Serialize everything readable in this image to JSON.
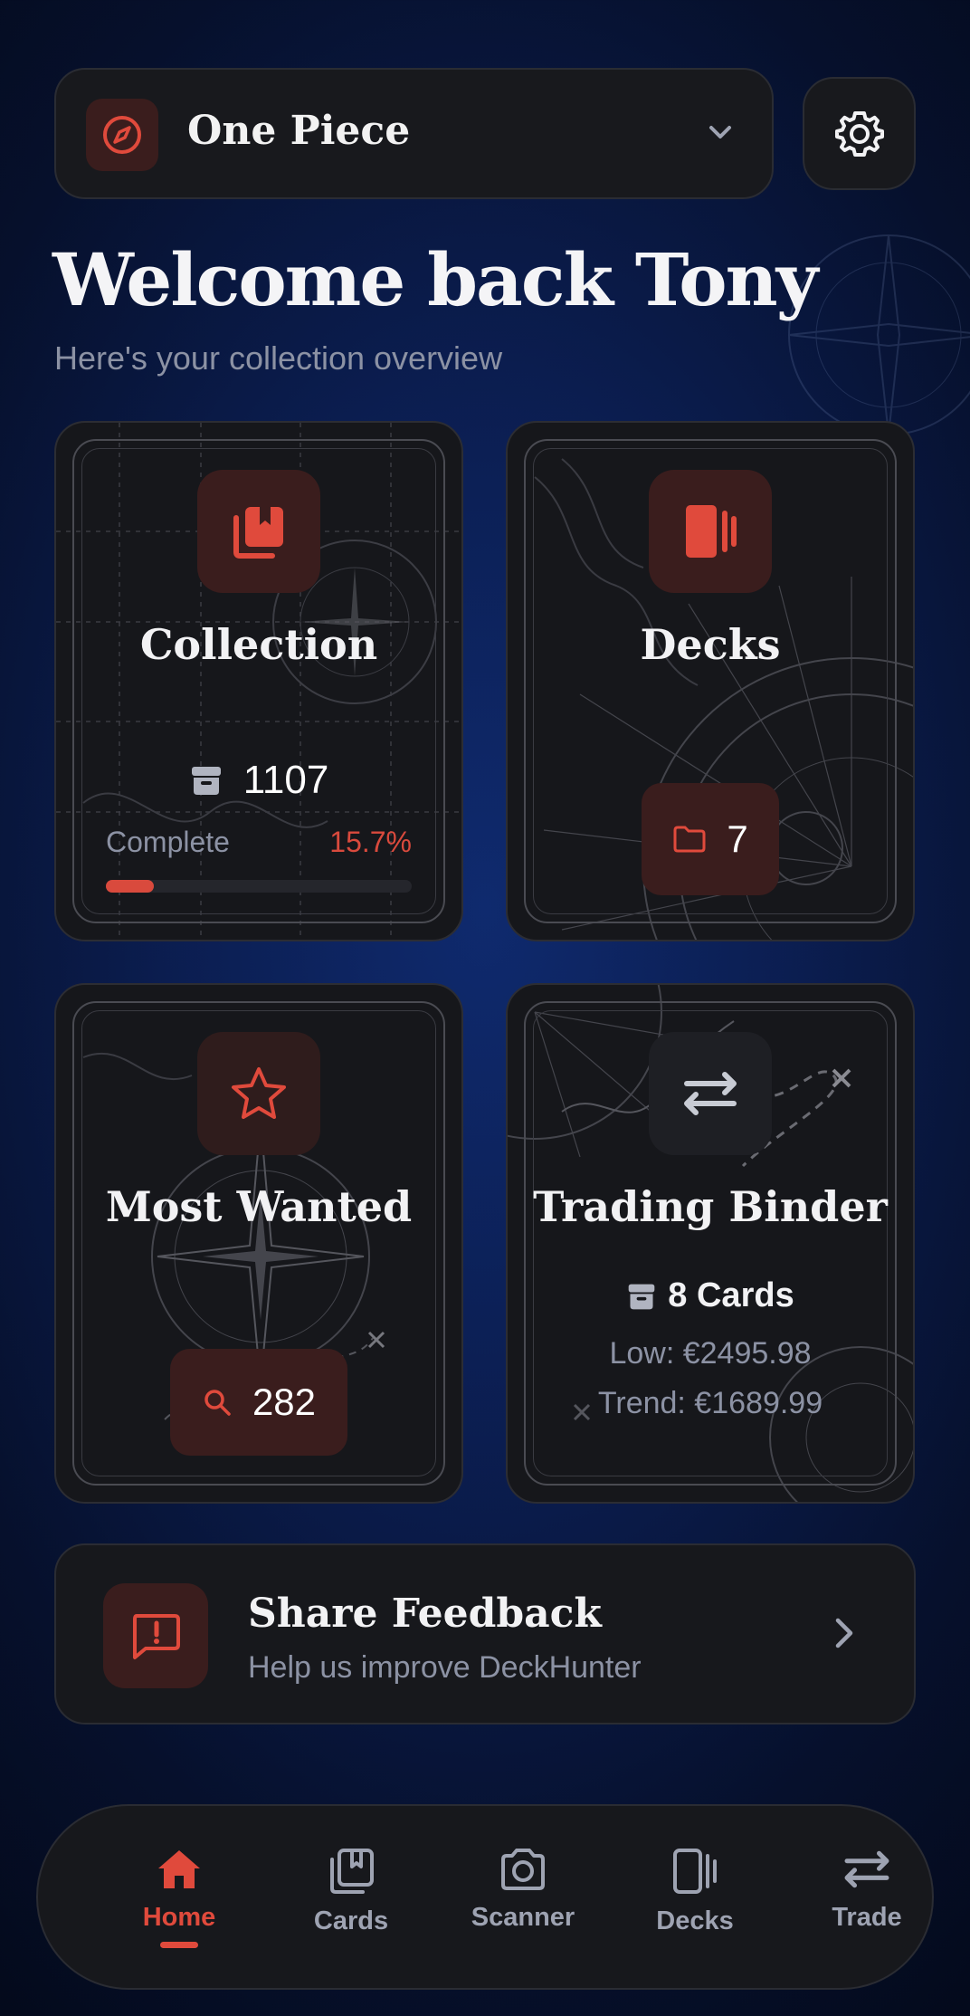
{
  "header": {
    "game_name": "One Piece",
    "settings_icon": "gear-icon",
    "game_icon": "compass-icon"
  },
  "welcome": {
    "title": "Welcome back Tony",
    "subtitle": "Here's your collection overview"
  },
  "cards": {
    "collection": {
      "title": "Collection",
      "count": "1107",
      "complete_label": "Complete",
      "complete_value": "15.7%",
      "progress": 0.157
    },
    "decks": {
      "title": "Decks",
      "count": "7"
    },
    "most_wanted": {
      "title": "Most Wanted",
      "count": "282"
    },
    "trading_binder": {
      "title": "Trading Binder",
      "cards": "8 Cards",
      "low": "Low: €2495.98",
      "trend": "Trend: €1689.99"
    }
  },
  "feedback": {
    "title": "Share Feedback",
    "subtitle": "Help us improve DeckHunter"
  },
  "nav": {
    "items": [
      {
        "label": "Home",
        "icon": "home-icon",
        "active": true
      },
      {
        "label": "Cards",
        "icon": "cards-icon",
        "active": false
      },
      {
        "label": "Scanner",
        "icon": "camera-icon",
        "active": false
      },
      {
        "label": "Decks",
        "icon": "decks-icon",
        "active": false
      },
      {
        "label": "Trade",
        "icon": "swap-icon",
        "active": false
      }
    ]
  },
  "colors": {
    "accent": "#e04a3c",
    "card_bg": "#16171b",
    "background": "#0b1d4f"
  }
}
